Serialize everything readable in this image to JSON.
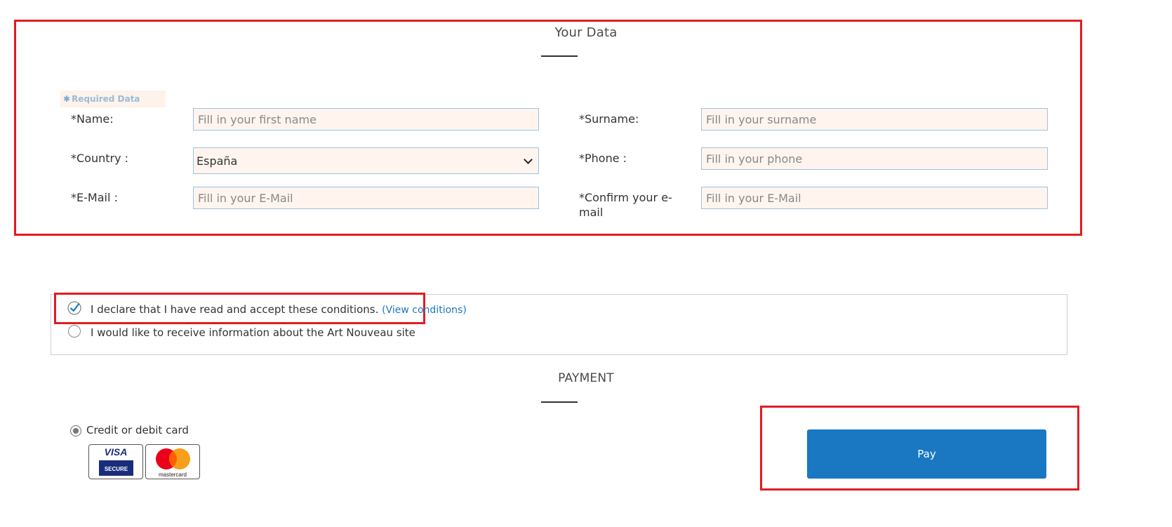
{
  "your_data": {
    "title": "Your Data",
    "required_note": "Required Data",
    "fields": {
      "name": {
        "label": "*Name:",
        "placeholder": "Fill in your first name",
        "value": ""
      },
      "surname": {
        "label": "*Surname:",
        "placeholder": "Fill in your surname",
        "value": ""
      },
      "country": {
        "label": "*Country :",
        "selected": "España"
      },
      "phone": {
        "label": "*Phone :",
        "placeholder": "Fill in your phone",
        "value": ""
      },
      "email": {
        "label": "*E-Mail :",
        "placeholder": "Fill in your E-Mail",
        "value": ""
      },
      "confirm_email": {
        "label": "*Confirm your e-mail",
        "placeholder": "Fill in your E-Mail",
        "value": ""
      }
    }
  },
  "conditions": {
    "accept_text": "I declare that I have read and accept these conditions.",
    "accept_checked": true,
    "view_link": "(View conditions)",
    "newsletter_text": "I would like to receive information about the Art Nouveau site",
    "newsletter_checked": false
  },
  "payment": {
    "title": "PAYMENT",
    "method_label": "Credit or debit card",
    "method_selected": true,
    "visa_text": "VISA",
    "visa_secure_text": "SECURE",
    "mastercard_text": "mastercard",
    "pay_label": "Pay"
  },
  "colors": {
    "highlight_red": "#e21b23",
    "pay_blue": "#1a78c2",
    "link_blue": "#1b78c0",
    "input_bg": "#fff5ee",
    "input_border": "#9cc3e0"
  },
  "icons": {
    "required": "asterisk-icon",
    "select": "chevron-down-icon",
    "checkbox": "check-circle-icon",
    "visa": "visa-secure-logo",
    "mastercard": "mastercard-logo"
  }
}
